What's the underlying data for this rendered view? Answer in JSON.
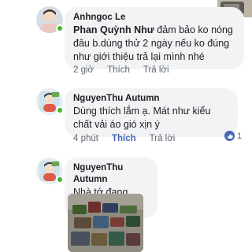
{
  "comments": [
    {
      "author": "Anhngoc Le",
      "mention": "Phan Quỳnh Như",
      "text": " đảm bảo ko nóng đâu b.dùng thử 2 ngày nếu ko đúng như giới thiệu trả lại mình nhé",
      "time": "2 giờ",
      "like_label": "Thích",
      "reply_label": "Trả lời"
    },
    {
      "author": "NguyenThu Autumn",
      "text": "Dùng thích lắm ạ.  Mát như kiểu chất vải áo gió xịn ý",
      "time": "4 phút",
      "like_label": "Thích",
      "reply_label": "Trả lời",
      "reaction_count": "1"
    },
    {
      "author": "NguyenThu Autumn",
      "text": "Nhà tớ đang dùng"
    }
  ],
  "colors": {
    "accent": "#4267b2",
    "online": "#42b72a",
    "bubble": "#f2f3f5",
    "meta": "#606770"
  }
}
